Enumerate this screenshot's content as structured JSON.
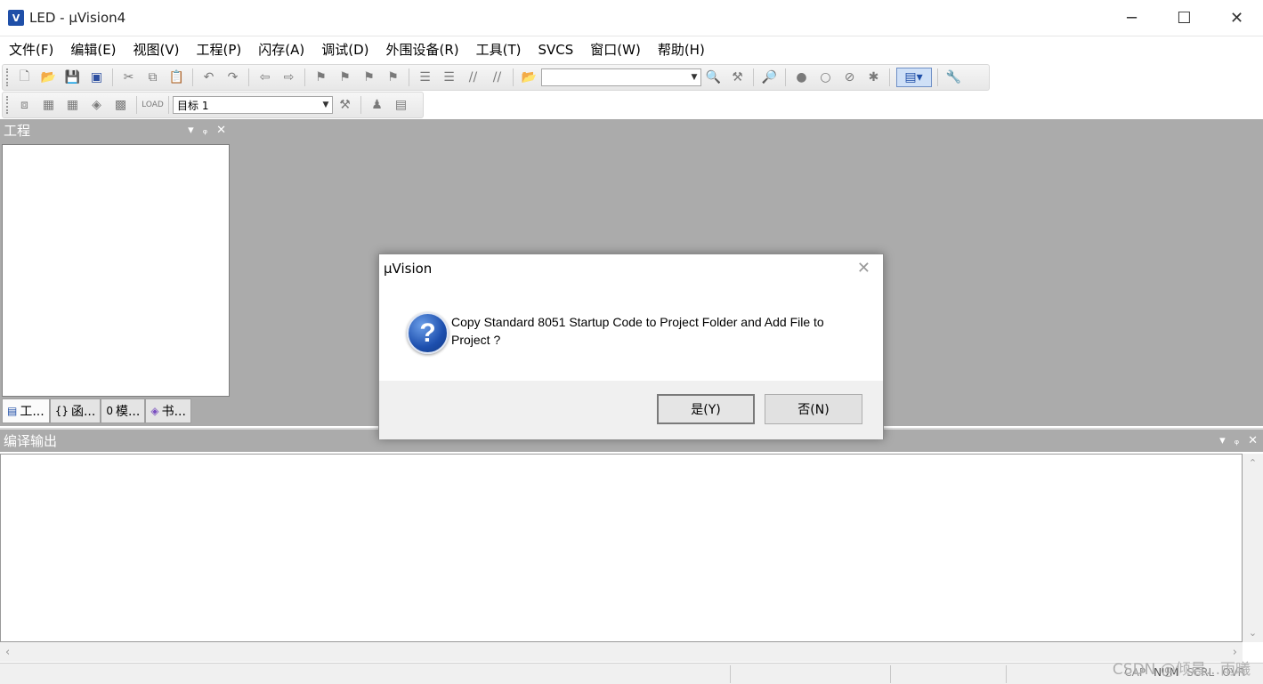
{
  "window": {
    "app_icon": "uvision-icon",
    "title": "LED  - µVision4",
    "minimize": "─",
    "maximize": "☐",
    "close": "✕"
  },
  "menu": [
    "文件(F)",
    "编辑(E)",
    "视图(V)",
    "工程(P)",
    "闪存(A)",
    "调试(D)",
    "外围设备(R)",
    "工具(T)",
    "SVCS",
    "窗口(W)",
    "帮助(H)"
  ],
  "toolbar2": {
    "target_value": "目标 1"
  },
  "project_panel": {
    "title": "工程",
    "tabs": [
      {
        "icon": "▤",
        "label": "工..."
      },
      {
        "icon": "{}",
        "label": "函..."
      },
      {
        "icon": "0",
        "label": "模..."
      },
      {
        "icon": "◈",
        "label": "书..."
      }
    ]
  },
  "output_panel": {
    "title": "编译输出"
  },
  "panel_controls": {
    "dropdown": "▾",
    "pin": "ᵩ",
    "close": "✕"
  },
  "statusbar": {
    "flags": [
      "CAP",
      "NUM",
      "SCRL",
      "OVR"
    ],
    "active_flag": "NUM"
  },
  "watermark": "CSDN @倾晨...雨曦",
  "dialog": {
    "title": "µVision",
    "close": "✕",
    "icon": "question-icon",
    "icon_glyph": "?",
    "message": "Copy Standard 8051 Startup Code to Project Folder and Add File to Project ?",
    "yes_label": "是(Y)",
    "no_label": "否(N)"
  }
}
